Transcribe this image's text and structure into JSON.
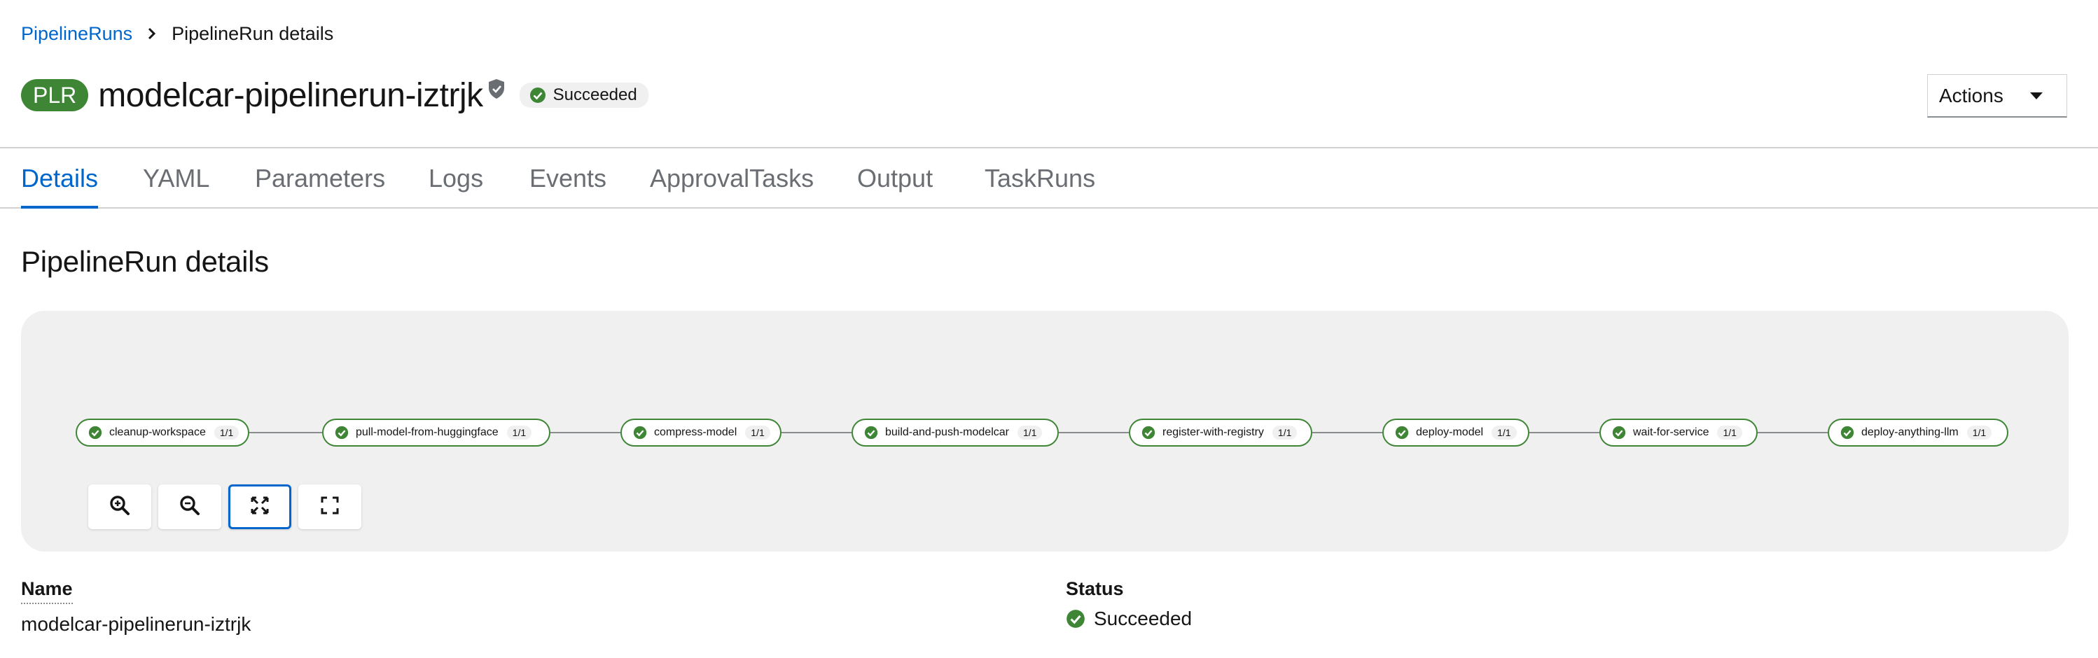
{
  "breadcrumb": {
    "parent": "PipelineRuns",
    "current": "PipelineRun details"
  },
  "header": {
    "badge": "PLR",
    "title": "modelcar-pipelinerun-iztrjk",
    "status": "Succeeded",
    "actions_label": "Actions"
  },
  "tabs": [
    {
      "label": "Details",
      "active": true
    },
    {
      "label": "YAML"
    },
    {
      "label": "Parameters"
    },
    {
      "label": "Logs"
    },
    {
      "label": "Events"
    },
    {
      "label": "ApprovalTasks"
    },
    {
      "label": "Output"
    },
    {
      "label": "TaskRuns"
    }
  ],
  "section_title": "PipelineRun details",
  "pipeline": {
    "tasks": [
      {
        "name": "cleanup-workspace",
        "count": "1/1"
      },
      {
        "name": "pull-model-from-huggingface",
        "count": "1/1"
      },
      {
        "name": "compress-model",
        "count": "1/1"
      },
      {
        "name": "build-and-push-modelcar",
        "count": "1/1"
      },
      {
        "name": "register-with-registry",
        "count": "1/1"
      },
      {
        "name": "deploy-model",
        "count": "1/1"
      },
      {
        "name": "wait-for-service",
        "count": "1/1"
      },
      {
        "name": "deploy-anything-llm",
        "count": "1/1"
      }
    ],
    "status_color": "#3e8635"
  },
  "controls": [
    "zoom-in-icon",
    "zoom-out-icon",
    "fit-to-screen-icon",
    "expand-icon"
  ],
  "details": {
    "name_label": "Name",
    "name_value": "modelcar-pipelinerun-iztrjk",
    "status_label": "Status",
    "status_value": "Succeeded"
  },
  "colors": {
    "accent": "#0066cc",
    "success": "#3e8635"
  }
}
